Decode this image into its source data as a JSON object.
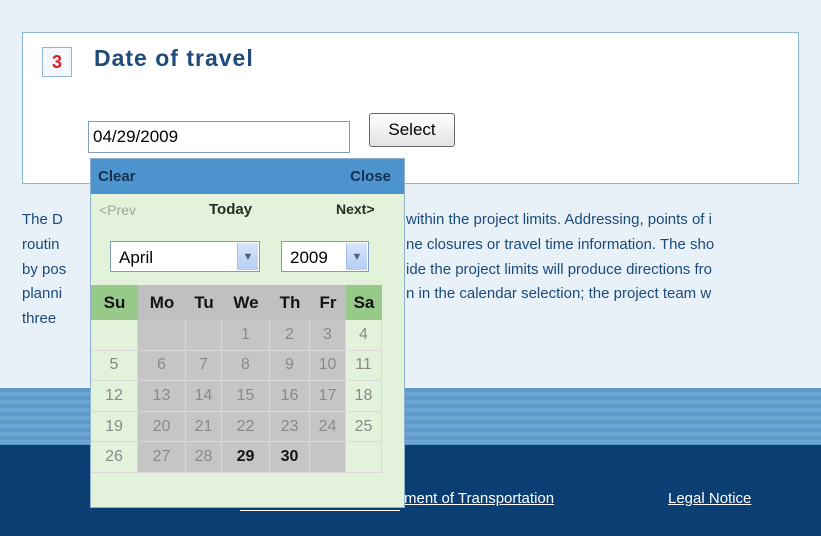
{
  "section": {
    "number": "3",
    "title": "Date of travel",
    "date_value": "04/29/2009",
    "select_label": "Select"
  },
  "body_text": {
    "lines": [
      {
        "left": "The D",
        "right": "within the project limits. Addressing, points of i"
      },
      {
        "left": "routin",
        "right": "ne closures or travel time information. The sho"
      },
      {
        "left": "by pos",
        "right": "ide the project limits will produce directions fro"
      },
      {
        "left": "planni",
        "right": "n in the calendar selection; the project team w"
      },
      {
        "left": "three",
        "right": ""
      }
    ]
  },
  "calendar": {
    "clear_label": "Clear",
    "close_label": "Close",
    "prev_label": "<Prev",
    "today_label": "Today",
    "next_label": "Next>",
    "month_selected": "April",
    "year_selected": "2009",
    "weekdays": [
      "Su",
      "Mo",
      "Tu",
      "We",
      "Th",
      "Fr",
      "Sa"
    ],
    "weeks": [
      [
        "",
        "",
        "",
        "1",
        "2",
        "3",
        "4"
      ],
      [
        "5",
        "6",
        "7",
        "8",
        "9",
        "10",
        "11"
      ],
      [
        "12",
        "13",
        "14",
        "15",
        "16",
        "17",
        "18"
      ],
      [
        "19",
        "20",
        "21",
        "22",
        "23",
        "24",
        "25"
      ],
      [
        "26",
        "27",
        "28",
        "29",
        "30",
        "",
        ""
      ]
    ],
    "available_days": [
      "29",
      "30"
    ]
  },
  "footer": {
    "links": [
      "ment of Transportation",
      "Legal Notice"
    ]
  },
  "colors": {
    "section_title": "#1f4a7c",
    "section_number": "#d6202a",
    "footer_bg": "#0b3f73",
    "calendar_header": "#4d94ce",
    "calendar_weekend": "#96c98a"
  }
}
